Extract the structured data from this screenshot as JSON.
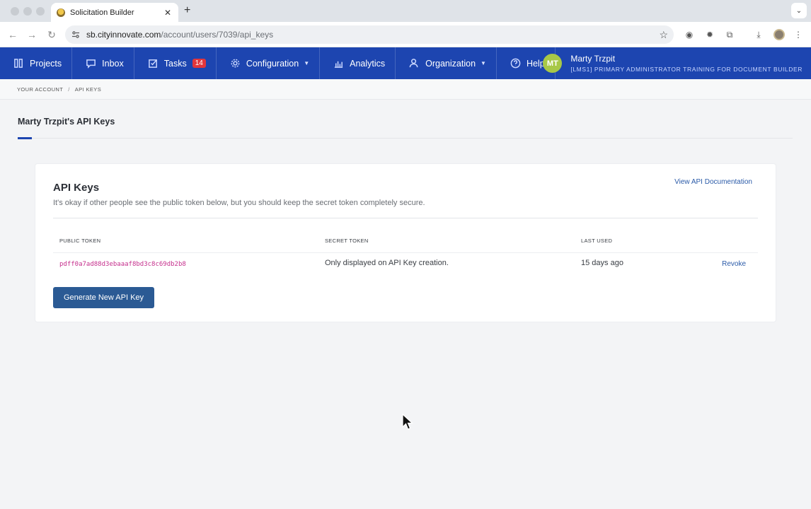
{
  "browser": {
    "tab_title": "Solicitation Builder",
    "tab_close": "✕",
    "new_tab": "+",
    "url_host": "sb.cityinnovate.com",
    "url_path": "/account/users/7039/api_keys"
  },
  "nav": {
    "items": [
      {
        "label": "Projects",
        "icon": "projects-icon"
      },
      {
        "label": "Inbox",
        "icon": "inbox-icon"
      },
      {
        "label": "Tasks",
        "icon": "tasks-icon",
        "badge": "14"
      },
      {
        "label": "Configuration",
        "icon": "gear-icon",
        "dropdown": true
      },
      {
        "label": "Analytics",
        "icon": "analytics-icon"
      },
      {
        "label": "Organization",
        "icon": "user-icon",
        "dropdown": true
      },
      {
        "label": "Help",
        "icon": "help-icon"
      }
    ],
    "user": {
      "initials": "MT",
      "name": "Marty Trzpit",
      "role": "[LMS1] PRIMARY ADMINISTRATOR TRAINING FOR DOCUMENT BUILDER"
    }
  },
  "breadcrumb": {
    "items": [
      "YOUR ACCOUNT",
      "API KEYS"
    ],
    "separator": "/"
  },
  "page": {
    "tab_label": "Marty Trzpit's API Keys"
  },
  "card": {
    "title": "API Keys",
    "description": "It's okay if other people see the public token below, but you should keep the secret token completely secure.",
    "doc_link": "View API Documentation",
    "table": {
      "headers": [
        "PUBLIC TOKEN",
        "SECRET TOKEN",
        "LAST USED"
      ],
      "rows": [
        {
          "public_token": "pdff0a7ad88d3ebaaaf8bd3c8c69db2b8",
          "secret_token": "Only displayed on API Key creation.",
          "last_used": "15 days ago",
          "action": "Revoke"
        }
      ]
    },
    "generate_button": "Generate New API Key"
  },
  "colors": {
    "nav_bg": "#1d45b0",
    "primary_button": "#2b5a94",
    "token_text": "#c52e8c",
    "link": "#2a5aa8",
    "badge": "#e2363c",
    "avatar": "#a8c847"
  }
}
